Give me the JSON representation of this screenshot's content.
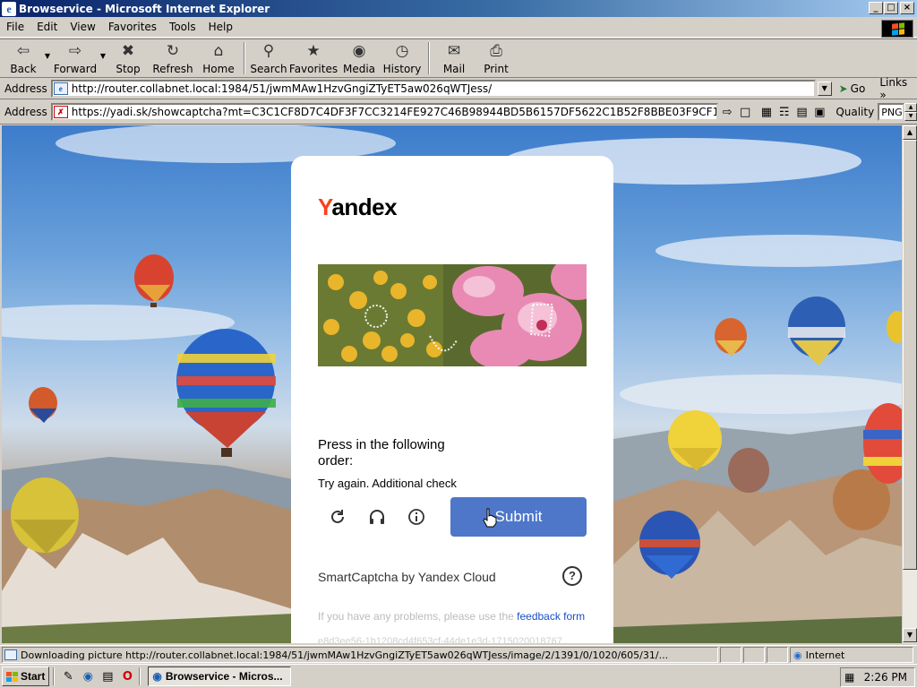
{
  "window": {
    "title": "Browservice - Microsoft Internet Explorer",
    "controls": [
      "_",
      "□",
      "×"
    ]
  },
  "menu": [
    "File",
    "Edit",
    "View",
    "Favorites",
    "Tools",
    "Help"
  ],
  "toolbar": {
    "back": "Back",
    "forward": "Forward",
    "stop": "Stop",
    "refresh": "Refresh",
    "home": "Home",
    "search": "Search",
    "favorites": "Favorites",
    "media": "Media",
    "history": "History",
    "mail": "Mail",
    "print": "Print"
  },
  "address_bar": {
    "label": "Address",
    "url": "http://router.collabnet.local:1984/51/jwmMAw1HzvGngiZTyET5aw026qWTJess/",
    "go_label": "Go",
    "links_label": "Links"
  },
  "browservice_bar": {
    "label": "Address",
    "url": "https://yadi.sk/showcaptcha?mt=C3C1CF8D7C4DF3F7CC3214FE927C46B98944BD5B6157DF5622C1B52F8BBE03F9CF145D6C148F",
    "quality_label": "Quality",
    "quality_value": "PNG"
  },
  "captcha": {
    "brand_first": "Y",
    "brand_rest": "andex",
    "prompt": "Press in the following order:",
    "retry_message": "Try again. Additional check",
    "submit_label": "Submit",
    "provider": "SmartCaptcha by Yandex Cloud",
    "help_text": "?",
    "problems_text": "If you have any problems, please use the ",
    "feedback_link": "feedback form",
    "hash": "e8d3ee56-1b1208cd4f653cf-44de1e3d-1715020018767"
  },
  "status_bar": {
    "text": "Downloading picture http://router.collabnet.local:1984/51/jwmMAw1HzvGngiZTyET5aw026qWTJess/image/2/1391/0/1020/605/31/...",
    "zone": "Internet"
  },
  "taskbar": {
    "start_label": "Start",
    "task_label": "Browservice - Micros...",
    "clock": "2:26 PM"
  },
  "colors": {
    "title_gradient_start": "#0a246a",
    "submit_bg": "#4e77c9",
    "yandex_red": "#fc3f1d",
    "link_blue": "#1a4fc9"
  }
}
